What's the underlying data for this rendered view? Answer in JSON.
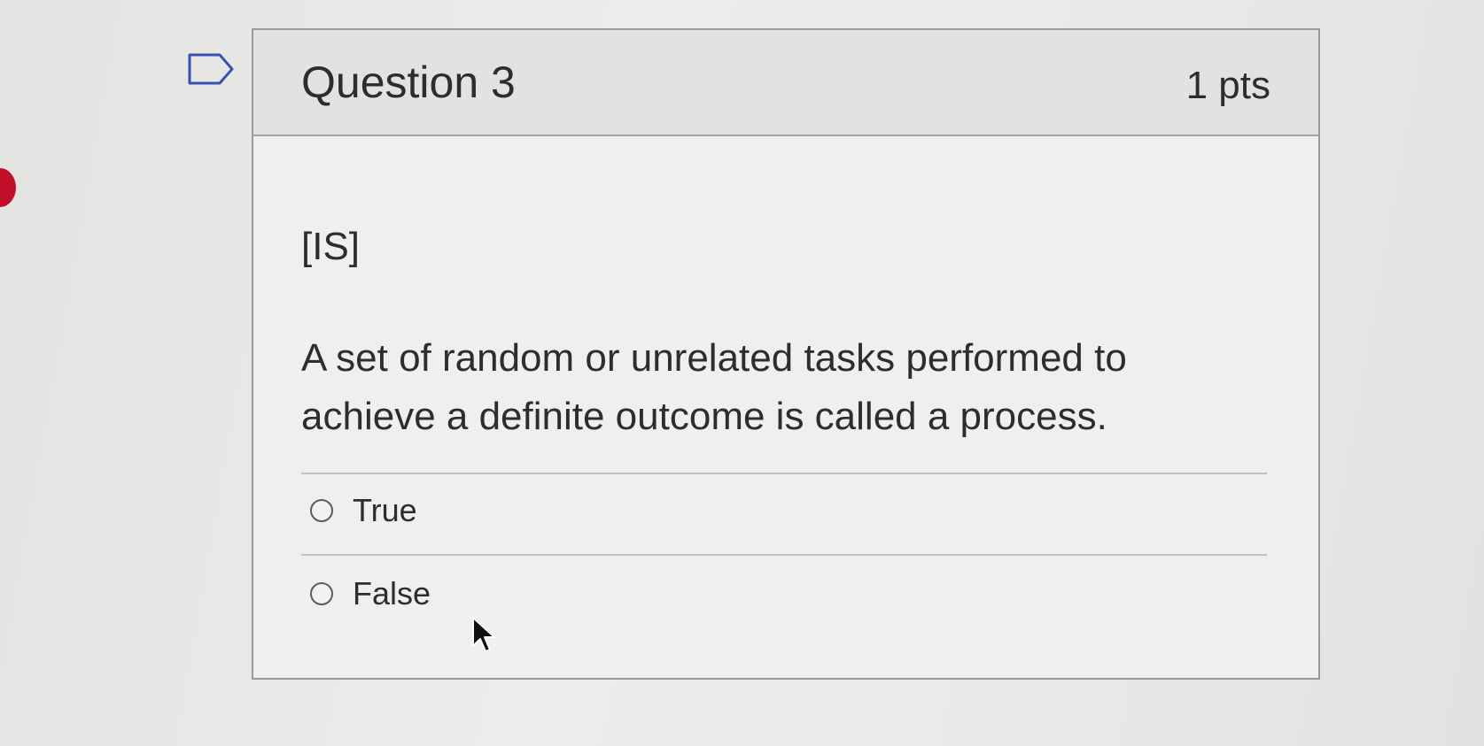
{
  "question": {
    "title": "Question 3",
    "points": "1 pts",
    "tag": "[IS]",
    "text": "A set of random or unrelated tasks performed to achieve a definite outcome is called a process."
  },
  "answers": [
    {
      "label": "True",
      "selected": false
    },
    {
      "label": "False",
      "selected": false
    }
  ],
  "icons": {
    "flag": "flag-question-icon",
    "cursor": "mouse-pointer-icon"
  },
  "colors": {
    "marker": "#c3102a",
    "text": "#2d2d2d"
  }
}
